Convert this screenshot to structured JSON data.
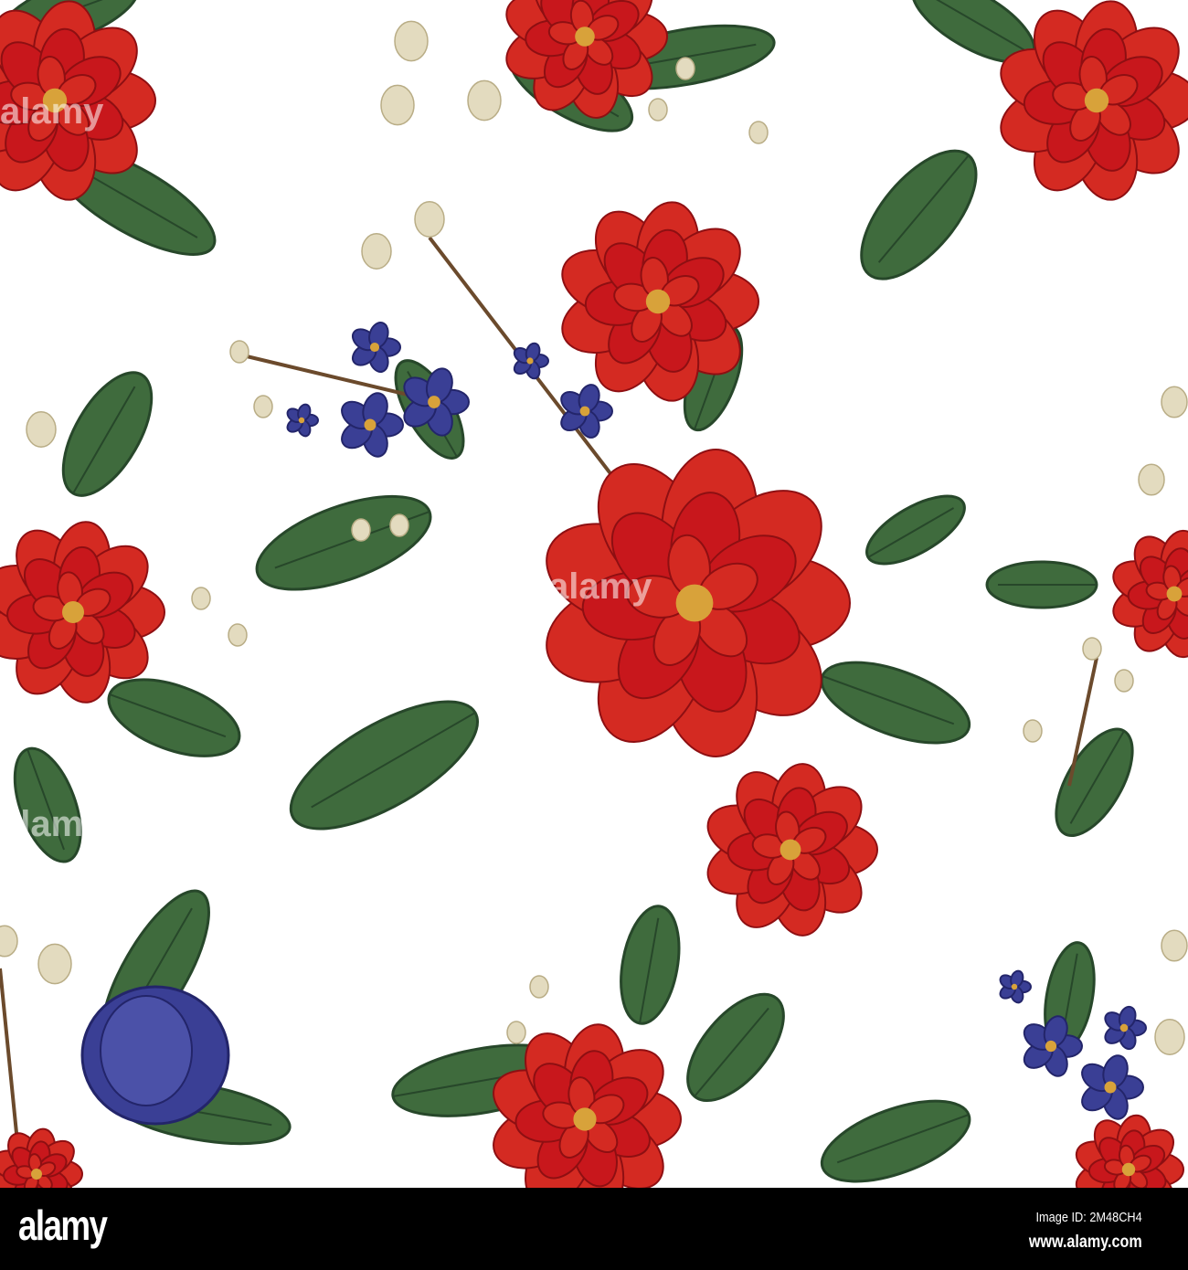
{
  "artwork": {
    "description_title": "Seamless floral pattern",
    "colors": {
      "background": "#ffffff",
      "red": "#c8171c",
      "red_dark": "#8e0f12",
      "blue": "#3a3f95",
      "blue_dark": "#23256a",
      "leaf": "#3f6b3d",
      "leaf_dark": "#27472a",
      "bud": "#e3dbbf",
      "stamen": "#d8a23a"
    }
  },
  "watermark": "alamy",
  "footer": {
    "logo": "alamy",
    "image_id": "Image ID: 2M48CH4",
    "url": "www.alamy.com"
  }
}
